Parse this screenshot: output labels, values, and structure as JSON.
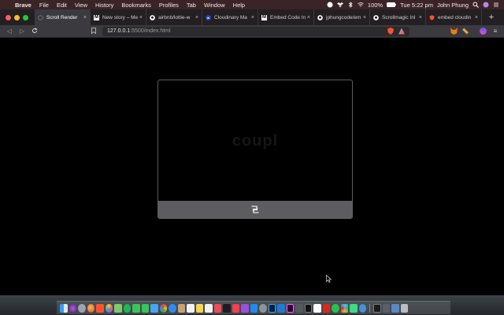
{
  "menubar": {
    "app_name": "Brave",
    "menus": [
      "File",
      "Edit",
      "View",
      "History",
      "Bookmarks",
      "Profiles",
      "Tab",
      "Window",
      "Help"
    ],
    "battery": "100%",
    "clock": "Tue 5:22 pm",
    "user": "John Phung"
  },
  "tabs": [
    {
      "title": "Scroll Render",
      "favicon": "loading-icon",
      "active": true
    },
    {
      "title": "New story – Me",
      "favicon": "medium-icon",
      "active": false
    },
    {
      "title": "airbnb/lottie-w",
      "favicon": "github-icon",
      "active": false
    },
    {
      "title": "Cloudinary Ma",
      "favicon": "cloudinary-icon",
      "active": false
    },
    {
      "title": "Embed Code In",
      "favicon": "medium-icon",
      "active": false
    },
    {
      "title": "jphungcode/em",
      "favicon": "github-icon",
      "active": false
    },
    {
      "title": "Scrollmagic Inl",
      "favicon": "github-icon",
      "active": false
    },
    {
      "title": "embed cloudin",
      "favicon": "brave-icon",
      "active": false
    }
  ],
  "address_bar": {
    "host": "127.0.0.1",
    "path": ":5500/index.html"
  },
  "embed": {
    "faded_text": "coupl"
  },
  "colors": {
    "menubar_bg": "#3a2426",
    "tabstrip_bg": "#231f22",
    "page_bg": "#000000",
    "embed_bar": "#5d5d5f"
  }
}
